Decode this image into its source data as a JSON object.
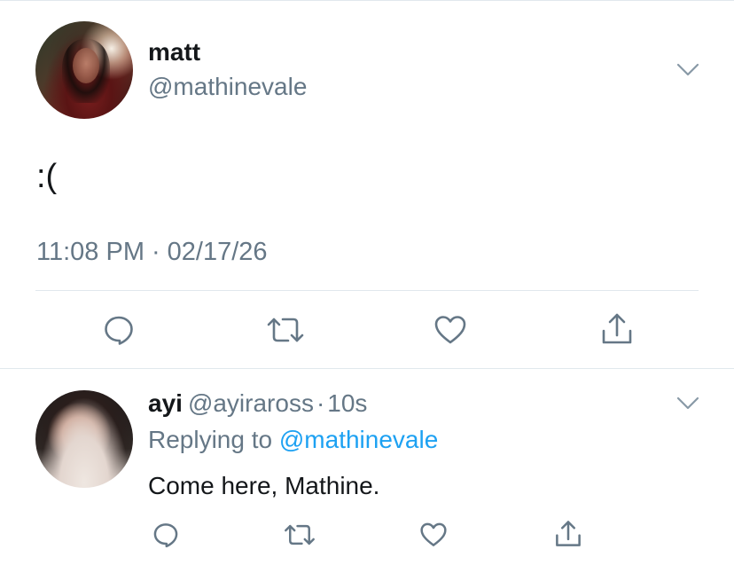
{
  "main_tweet": {
    "author_name": "matt",
    "author_handle": "@mathinevale",
    "text": ":(",
    "time": "11:08 PM",
    "separator": "·",
    "date": "02/17/26"
  },
  "reply": {
    "author_name": "ayi",
    "author_handle": "@ayiraross",
    "separator": "·",
    "time_ago": "10s",
    "replying_prefix": "Replying to",
    "replying_to": "@mathinevale",
    "text": "Come here, Mathine."
  },
  "icons": {
    "reply": "reply-bubble-icon",
    "retweet": "retweet-icon",
    "like": "heart-icon",
    "share": "share-icon",
    "more": "chevron-down-icon"
  },
  "colors": {
    "text_primary": "#14171a",
    "text_secondary": "#657786",
    "link": "#1da1f2",
    "icon": "#657786",
    "divider": "#e1e8ed"
  }
}
